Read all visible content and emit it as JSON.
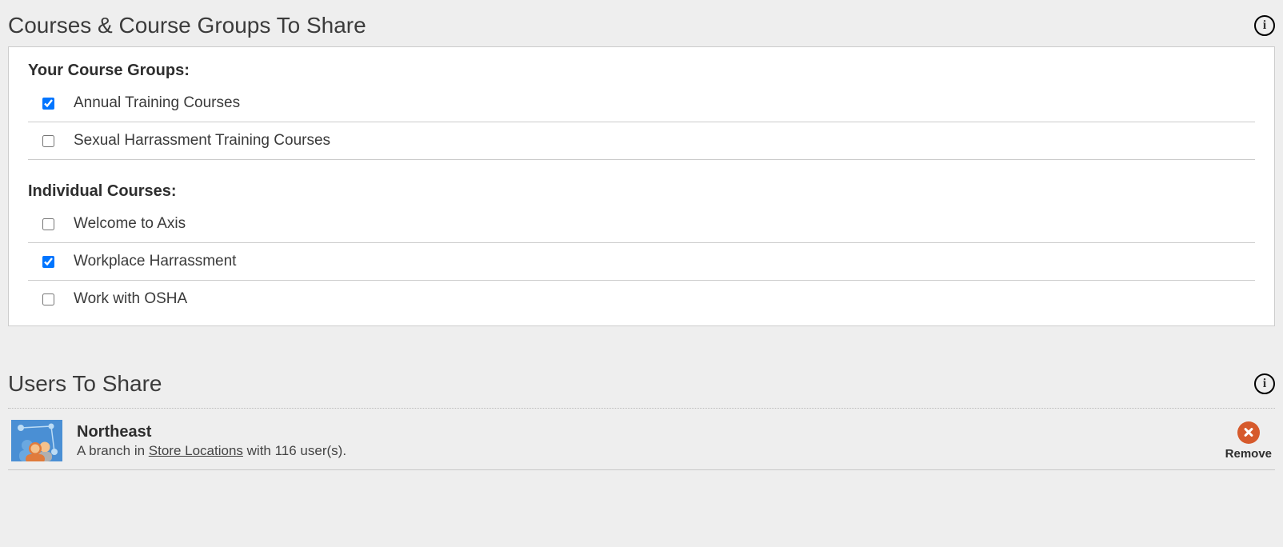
{
  "courses": {
    "title": "Courses & Course Groups To Share",
    "groups_heading": "Your Course Groups:",
    "groups": [
      {
        "label": "Annual Training Courses",
        "checked": true
      },
      {
        "label": "Sexual Harrassment Training Courses",
        "checked": false
      }
    ],
    "individual_heading": "Individual Courses:",
    "individual": [
      {
        "label": "Welcome to Axis",
        "checked": false
      },
      {
        "label": "Workplace Harrassment",
        "checked": true
      },
      {
        "label": "Work with OSHA",
        "checked": false
      }
    ]
  },
  "users": {
    "title": "Users To Share",
    "entries": [
      {
        "name": "Northeast",
        "desc_prefix": "A branch in ",
        "desc_link": "Store Locations",
        "desc_suffix": " with 116 user(s).",
        "remove_label": "Remove"
      }
    ]
  }
}
